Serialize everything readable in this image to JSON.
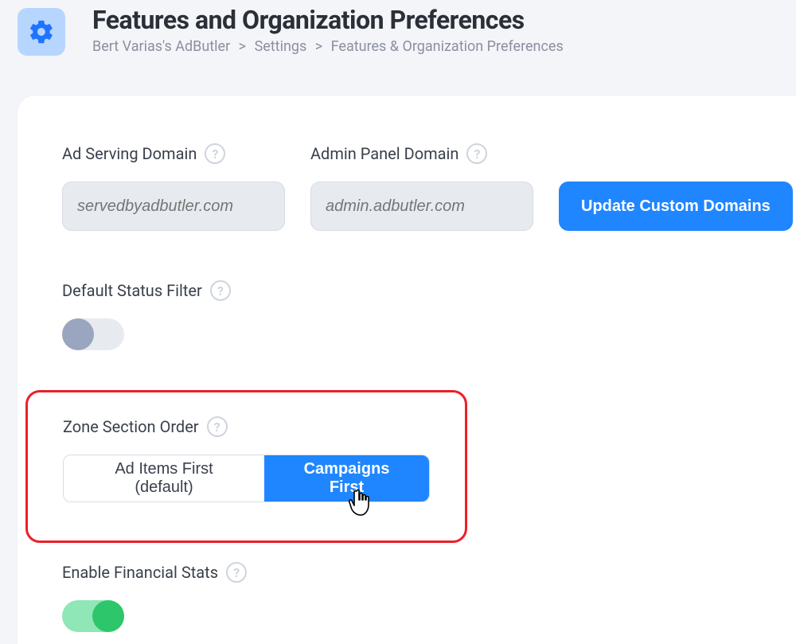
{
  "header": {
    "title": "Features and Organization Preferences",
    "breadcrumb": {
      "org": "Bert Varias's AdButler",
      "settings": "Settings",
      "current": "Features & Organization Preferences"
    }
  },
  "domains": {
    "serving_label": "Ad Serving Domain",
    "serving_placeholder": "servedbyadbutler.com",
    "admin_label": "Admin Panel Domain",
    "admin_placeholder": "admin.adbutler.com",
    "update_button": "Update Custom Domains"
  },
  "status_filter": {
    "label": "Default Status Filter",
    "value": "off"
  },
  "zone_order": {
    "label": "Zone Section Order",
    "option_a": "Ad Items First (default)",
    "option_b": "Campaigns First",
    "selected": "b"
  },
  "financial": {
    "label": "Enable Financial Stats",
    "value": "on"
  },
  "glyphs": {
    "help": "?"
  }
}
